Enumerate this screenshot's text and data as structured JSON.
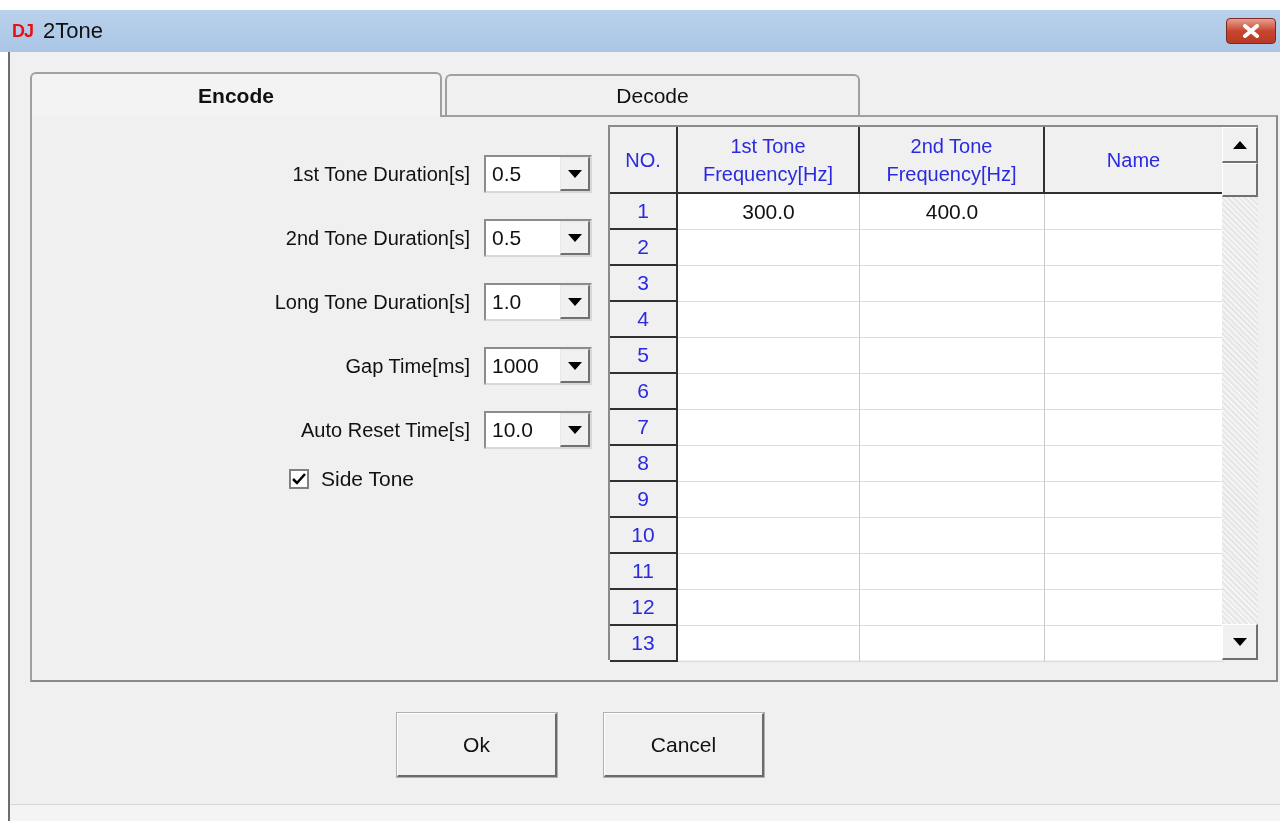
{
  "window": {
    "app_icon": "DJ",
    "title": "2Tone"
  },
  "tabs": [
    {
      "label": "Encode",
      "selected": true
    },
    {
      "label": "Decode",
      "selected": false
    }
  ],
  "settings": [
    {
      "label": "1st Tone Duration[s]",
      "value": "0.5"
    },
    {
      "label": "2nd Tone Duration[s]",
      "value": "0.5"
    },
    {
      "label": "Long Tone Duration[s]",
      "value": "1.0"
    },
    {
      "label": "Gap Time[ms]",
      "value": "1000"
    },
    {
      "label": "Auto Reset Time[s]",
      "value": "10.0"
    }
  ],
  "side_tone": {
    "label": "Side Tone",
    "checked": true
  },
  "table": {
    "columns": [
      "NO.",
      "1st Tone Frequency[Hz]",
      "2nd Tone Frequency[Hz]",
      "Name"
    ],
    "rows": [
      {
        "no": "1",
        "tone1": "300.0",
        "tone2": "400.0"
      },
      {
        "no": "2"
      },
      {
        "no": "3"
      },
      {
        "no": "4"
      },
      {
        "no": "5"
      },
      {
        "no": "6"
      },
      {
        "no": "7"
      },
      {
        "no": "8"
      },
      {
        "no": "9"
      },
      {
        "no": "10"
      },
      {
        "no": "11"
      },
      {
        "no": "12"
      },
      {
        "no": "13"
      }
    ]
  },
  "buttons": [
    "Ok",
    "Cancel"
  ]
}
